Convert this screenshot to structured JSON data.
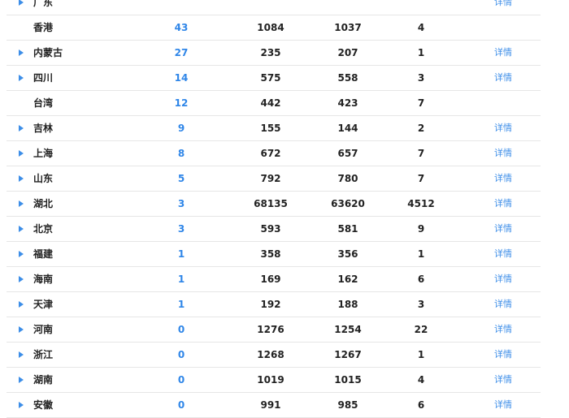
{
  "partial_top_row": {
    "region": "广东",
    "count": "",
    "c1": "",
    "c2": "",
    "c3": "",
    "detail": "详情"
  },
  "rows": [
    {
      "region": "香港",
      "count": "43",
      "c1": "1084",
      "c2": "1037",
      "c3": "4",
      "detail": ""
    },
    {
      "region": "内蒙古",
      "count": "27",
      "c1": "235",
      "c2": "207",
      "c3": "1",
      "detail": "详情"
    },
    {
      "region": "四川",
      "count": "14",
      "c1": "575",
      "c2": "558",
      "c3": "3",
      "detail": "详情"
    },
    {
      "region": "台湾",
      "count": "12",
      "c1": "442",
      "c2": "423",
      "c3": "7",
      "detail": ""
    },
    {
      "region": "吉林",
      "count": "9",
      "c1": "155",
      "c2": "144",
      "c3": "2",
      "detail": "详情"
    },
    {
      "region": "上海",
      "count": "8",
      "c1": "672",
      "c2": "657",
      "c3": "7",
      "detail": "详情"
    },
    {
      "region": "山东",
      "count": "5",
      "c1": "792",
      "c2": "780",
      "c3": "7",
      "detail": "详情"
    },
    {
      "region": "湖北",
      "count": "3",
      "c1": "68135",
      "c2": "63620",
      "c3": "4512",
      "detail": "详情"
    },
    {
      "region": "北京",
      "count": "3",
      "c1": "593",
      "c2": "581",
      "c3": "9",
      "detail": "详情"
    },
    {
      "region": "福建",
      "count": "1",
      "c1": "358",
      "c2": "356",
      "c3": "1",
      "detail": "详情"
    },
    {
      "region": "海南",
      "count": "1",
      "c1": "169",
      "c2": "162",
      "c3": "6",
      "detail": "详情"
    },
    {
      "region": "天津",
      "count": "1",
      "c1": "192",
      "c2": "188",
      "c3": "3",
      "detail": "详情"
    },
    {
      "region": "河南",
      "count": "0",
      "c1": "1276",
      "c2": "1254",
      "c3": "22",
      "detail": "详情"
    },
    {
      "region": "浙江",
      "count": "0",
      "c1": "1268",
      "c2": "1267",
      "c3": "1",
      "detail": "详情"
    },
    {
      "region": "湖南",
      "count": "0",
      "c1": "1019",
      "c2": "1015",
      "c3": "4",
      "detail": "详情"
    },
    {
      "region": "安徽",
      "count": "0",
      "c1": "991",
      "c2": "985",
      "c3": "6",
      "detail": "详情"
    }
  ],
  "colors": {
    "accent": "#3d8ee8",
    "count_text": "#2f86e8",
    "text": "#222222",
    "divider": "#e6e6e6"
  },
  "icons": {
    "expand": "expand-arrow-icon"
  }
}
